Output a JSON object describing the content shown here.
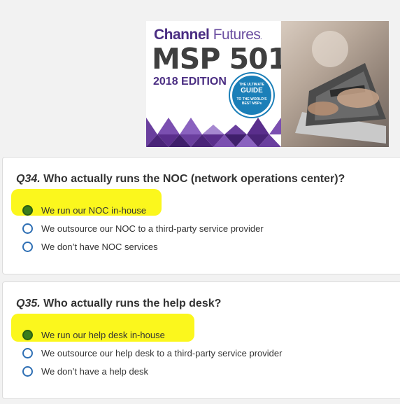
{
  "banner": {
    "brand_main": "Channel",
    "brand_secondary": "Futures",
    "brand_mark": ".",
    "title": "MSP 501",
    "edition": "2018 EDITION",
    "badge_top": "THE ULTIMATE",
    "badge_main": "GUIDE",
    "badge_bottom": "TO THE WORLD'S BEST MSPs"
  },
  "questions": [
    {
      "number": "Q34.",
      "text": " Who actually runs the NOC (network operations center)?",
      "options": [
        {
          "label": "We run our NOC in-house",
          "selected": true
        },
        {
          "label": "We outsource our NOC to a third-party service provider",
          "selected": false
        },
        {
          "label": "We don’t have NOC services",
          "selected": false
        }
      ]
    },
    {
      "number": "Q35.",
      "text": " Who actually runs the help desk?",
      "options": [
        {
          "label": "We run our help desk in-house",
          "selected": true
        },
        {
          "label": "We outsource our help desk to a third-party service provider",
          "selected": false
        },
        {
          "label": "We don’t have a help desk",
          "selected": false
        }
      ]
    }
  ],
  "colors": {
    "highlight": "#fbf71d",
    "radio_border": "#2e6fb4",
    "radio_selected": "#3a7d1c",
    "brand_purple": "#4a2d82"
  }
}
